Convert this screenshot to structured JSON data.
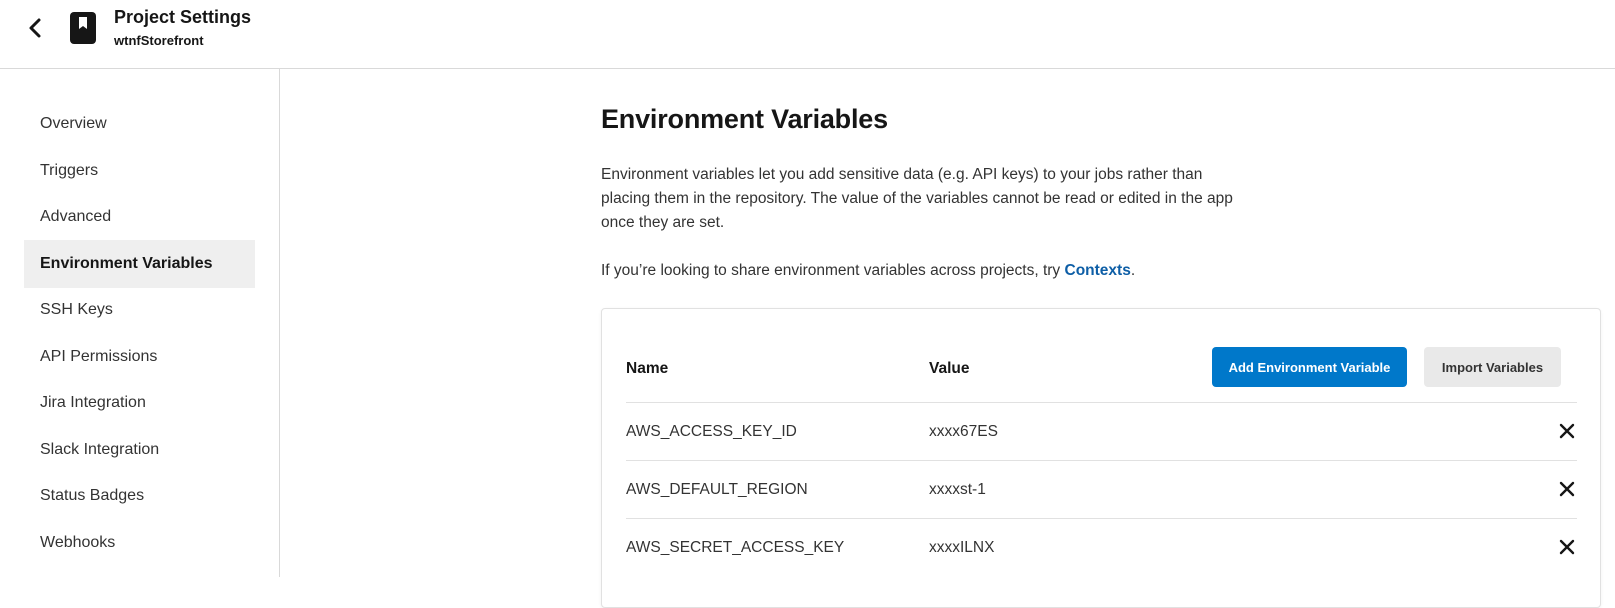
{
  "header": {
    "title": "Project Settings",
    "subtitle": "wtnfStorefront"
  },
  "sidebar": {
    "items": [
      {
        "label": "Overview"
      },
      {
        "label": "Triggers"
      },
      {
        "label": "Advanced"
      },
      {
        "label": "Environment Variables"
      },
      {
        "label": "SSH Keys"
      },
      {
        "label": "API Permissions"
      },
      {
        "label": "Jira Integration"
      },
      {
        "label": "Slack Integration"
      },
      {
        "label": "Status Badges"
      },
      {
        "label": "Webhooks"
      }
    ]
  },
  "main": {
    "title": "Environment Variables",
    "description": "Environment variables let you add sensitive data (e.g. API keys) to your jobs rather than placing them in the repository. The value of the variables cannot be read or edited in the app once they are set.",
    "contexts_prefix": "If you’re looking to share environment variables across projects, try ",
    "contexts_link": "Contexts",
    "contexts_suffix": ".",
    "table": {
      "name_header": "Name",
      "value_header": "Value",
      "add_button": "Add Environment Variable",
      "import_button": "Import Variables",
      "rows": [
        {
          "name": "AWS_ACCESS_KEY_ID",
          "value": "xxxx67ES"
        },
        {
          "name": "AWS_DEFAULT_REGION",
          "value": "xxxxst-1"
        },
        {
          "name": "AWS_SECRET_ACCESS_KEY",
          "value": "xxxxILNX"
        }
      ]
    }
  },
  "colors": {
    "primary": "#0078ca",
    "link": "#0d5ea6",
    "active_bg": "#efefef"
  }
}
